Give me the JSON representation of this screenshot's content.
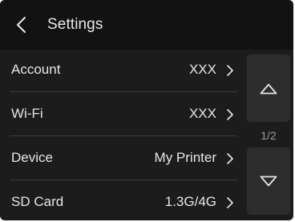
{
  "header": {
    "title": "Settings",
    "back_icon": "chevron-left-icon"
  },
  "settings": [
    {
      "label": "Account",
      "value": "XXX"
    },
    {
      "label": "Wi-Fi",
      "value": "XXX"
    },
    {
      "label": "Device",
      "value": "My Printer"
    },
    {
      "label": "SD Card",
      "value": "1.3G/4G"
    }
  ],
  "pager": {
    "indicator": "1/2",
    "up_icon": "triangle-up-icon",
    "down_icon": "triangle-down-icon"
  },
  "colors": {
    "background": "#1c1c1c",
    "header": "#121212",
    "button": "#2d2d2d",
    "text": "#e6e6e6",
    "muted_text": "#9a9a9a"
  }
}
